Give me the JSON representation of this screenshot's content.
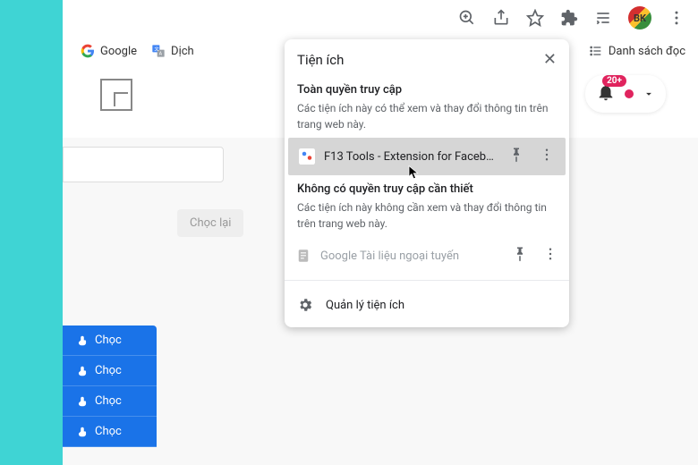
{
  "toolbar": {
    "avatar_text": "BK"
  },
  "bookmarks": {
    "google": "Google",
    "dich": "Dịch",
    "reading_list": "Danh sách đọc"
  },
  "notifications": {
    "badge": "20+"
  },
  "buttons": {
    "reset": "Chọc lại",
    "poke": "Chọc"
  },
  "popup": {
    "title": "Tiện ích",
    "sections": {
      "full": {
        "title": "Toàn quyền truy cập",
        "desc": "Các tiện ích này có thể xem và thay đổi thông tin trên trang web này."
      },
      "none": {
        "title": "Không có quyền truy cập cần thiết",
        "desc": "Các tiện ích này không cần xem và thay đổi thông tin trên trang web này."
      }
    },
    "items": {
      "f13": "F13 Tools - Extension for Faceb…",
      "gdocs": "Google Tài liệu ngoại tuyến"
    },
    "manage": "Quản lý tiện ích"
  }
}
